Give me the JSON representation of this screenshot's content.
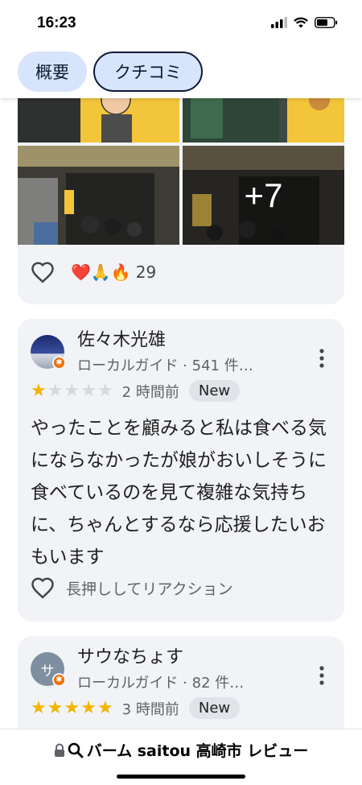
{
  "status_bar": {
    "time": "16:23"
  },
  "tabs": [
    {
      "label": "概要",
      "selected": false
    },
    {
      "label": "クチコミ",
      "selected": true
    }
  ],
  "photo_card": {
    "more_photos": "+7",
    "reactions": {
      "emojis": "❤️🙏🔥",
      "count": "29"
    }
  },
  "reviews": [
    {
      "name": "佐々木光雄",
      "meta": "ローカルガイド · 541 件…",
      "rating": 1,
      "time_ago": "2 時間前",
      "badge": "New",
      "text": "やったことを顧みると私は食べる気にならなかったが娘がおいしそうに食べているのを見て複雑な気持ちに、ちゃんとするなら応援したいおもいます",
      "react_prompt": "長押ししてリアクション"
    },
    {
      "avatar_letter": "サ",
      "name": "サウなちょす",
      "meta": "ローカルガイド · 82 件…",
      "rating": 5,
      "time_ago": "3 時間前",
      "badge": "New"
    }
  ],
  "url_bar": {
    "text": "バーム saitou 高崎市 レビュー"
  },
  "colors": {
    "star_on": "#f4b400",
    "star_off": "#d5d8dc",
    "chip_bg": "#d8e4fb",
    "card_bg": "#f1f3f6"
  }
}
